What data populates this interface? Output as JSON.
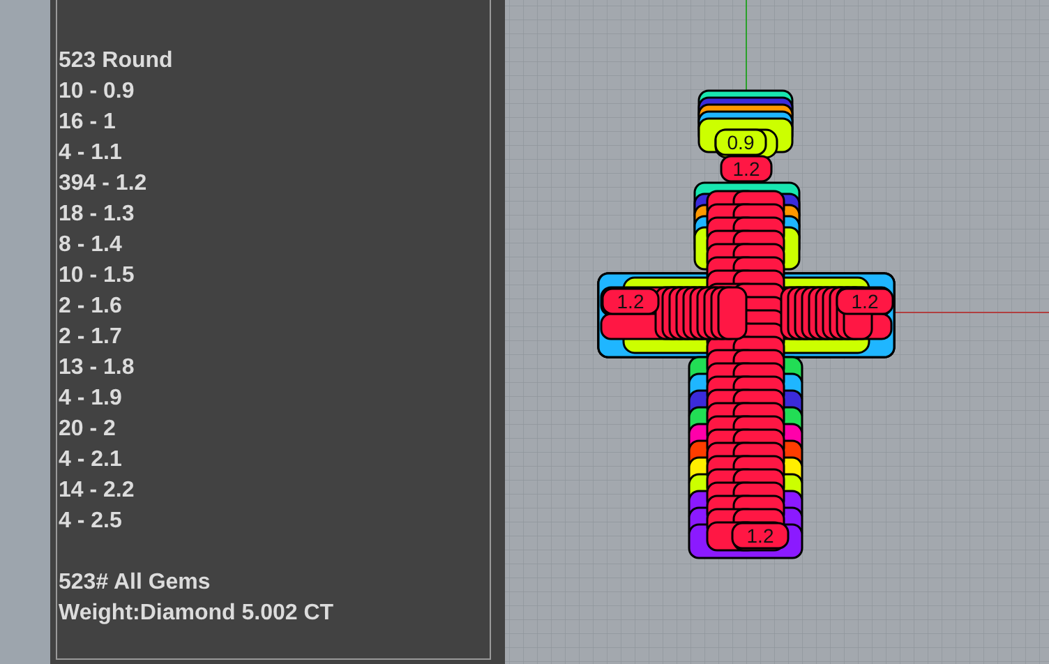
{
  "gem_report": {
    "heading": "523 Round",
    "counts": [
      "10 - 0.9",
      "16 - 1",
      "4 - 1.1",
      "394 - 1.2",
      "18 - 1.3",
      "8 - 1.4",
      "10 - 1.5",
      "2 - 1.6",
      "2 - 1.7",
      "13 - 1.8",
      "4 - 1.9",
      "20 - 2",
      "4 - 2.1",
      "14 - 2.2",
      "4 - 2.5"
    ],
    "total": "523# All Gems",
    "weight": "Weight:Diamond 5.002 CT"
  },
  "viewport": {
    "gem_labels": [
      {
        "text": "0.9",
        "color": "#ccff00"
      },
      {
        "text": "1.2",
        "color": "#ff1744"
      },
      {
        "text": "1.2",
        "color": "#ff1744"
      },
      {
        "text": "1.2",
        "color": "#ff1744"
      },
      {
        "text": "1.2",
        "color": "#ff1744"
      }
    ]
  }
}
